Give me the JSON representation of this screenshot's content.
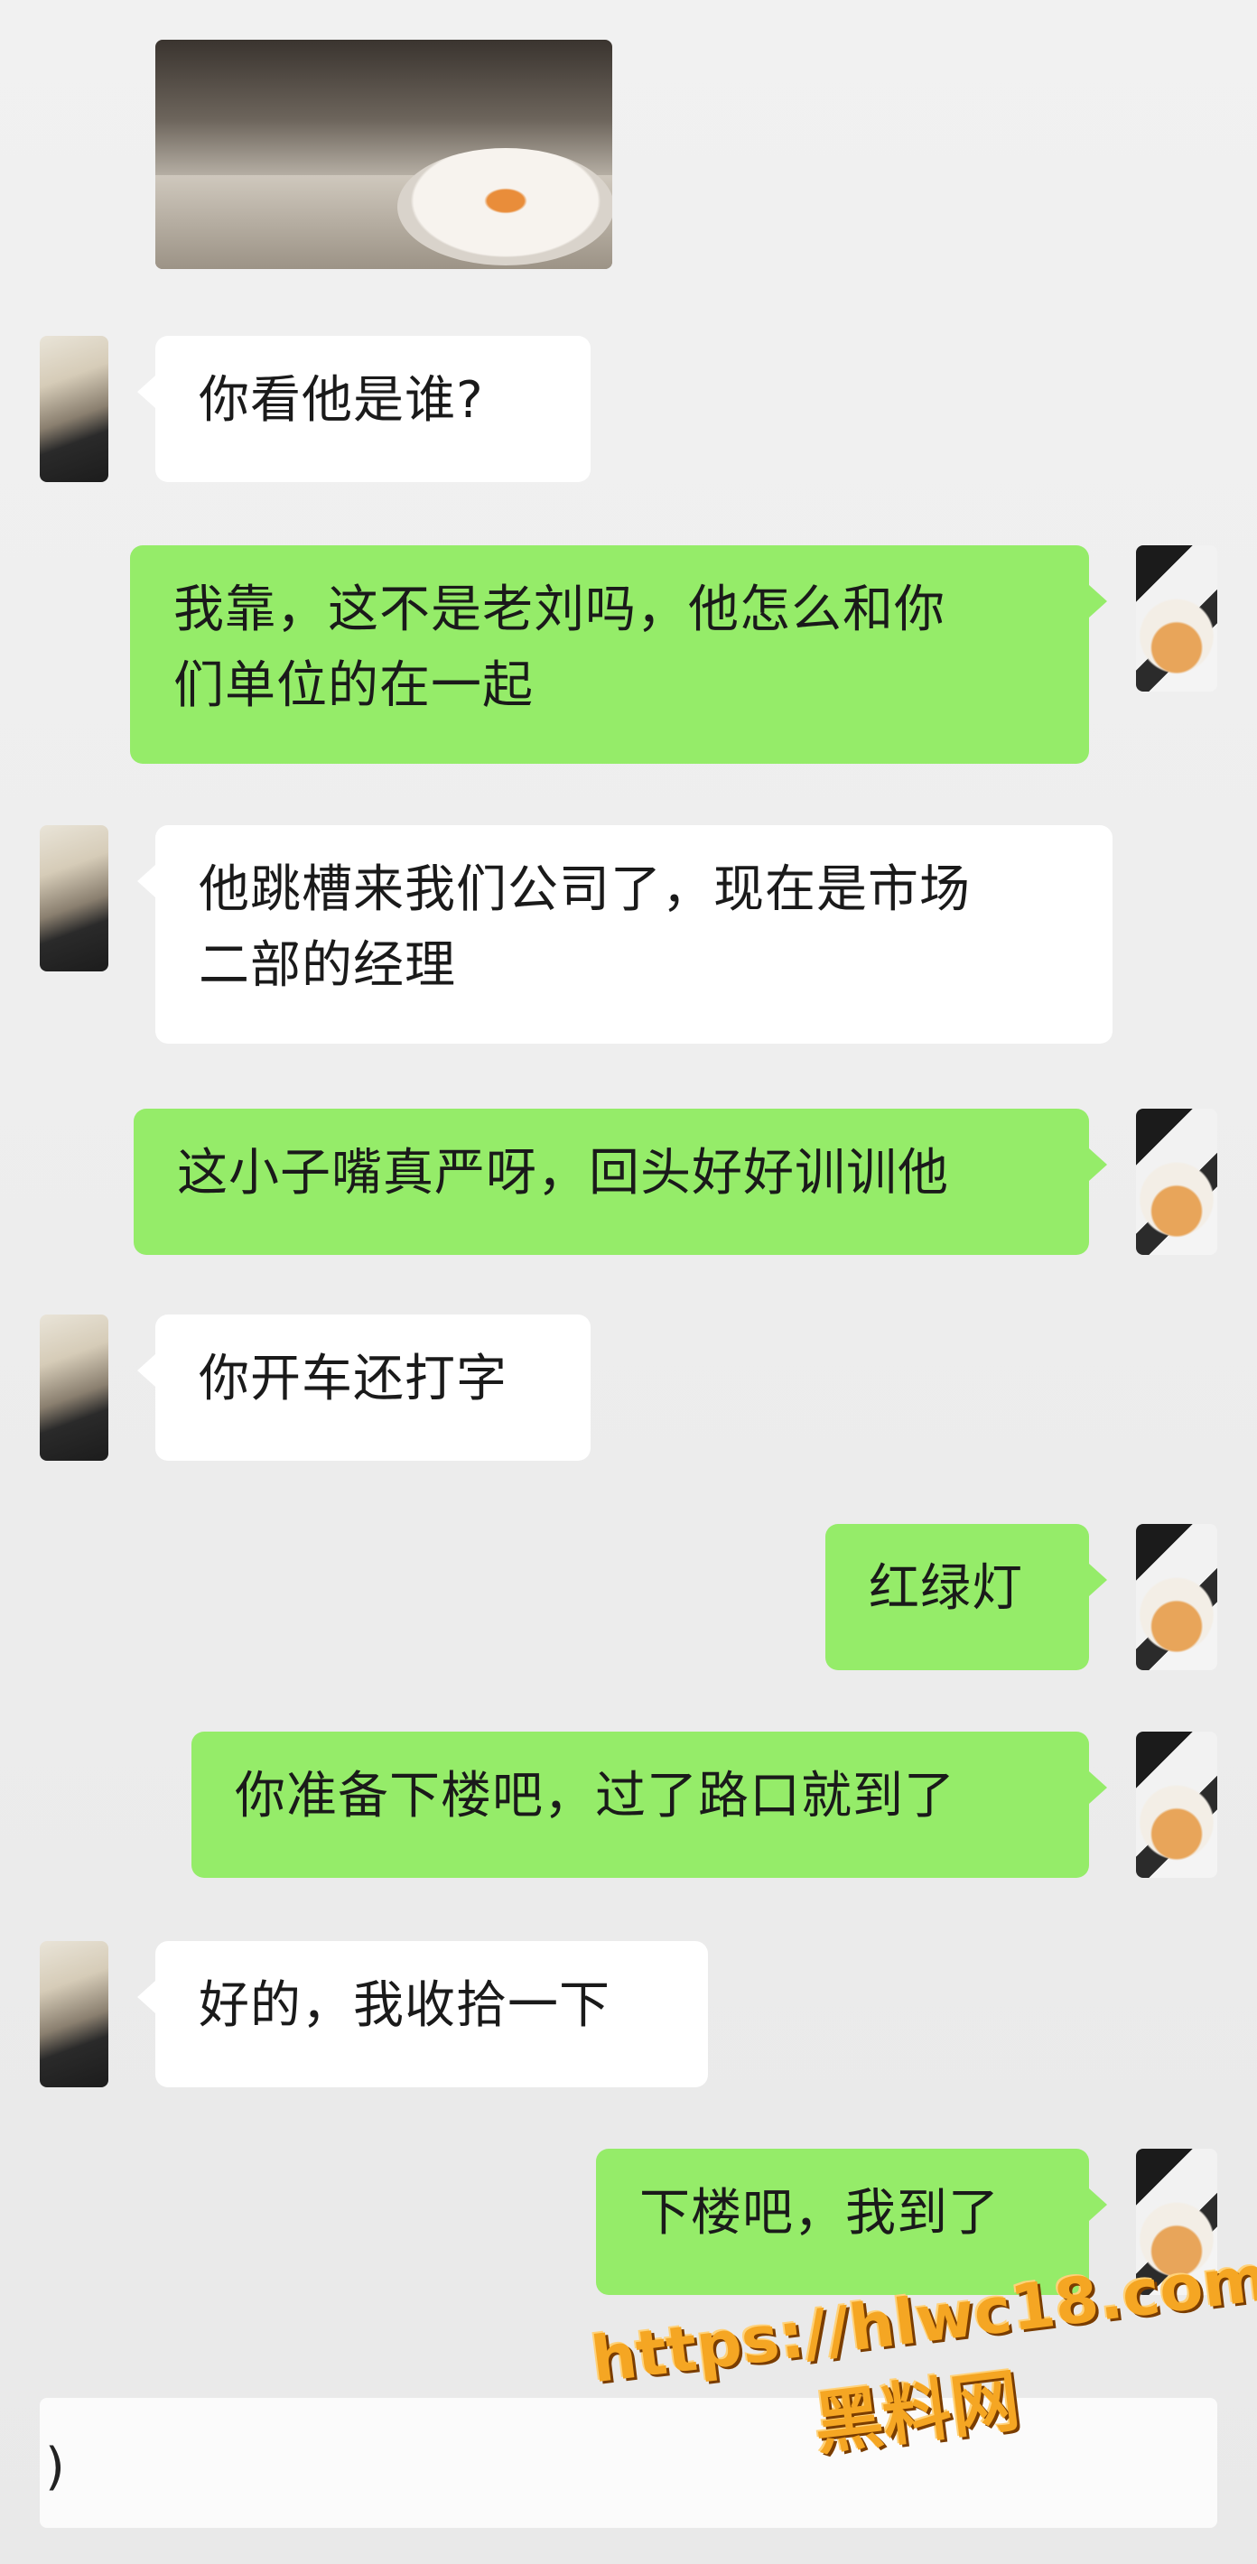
{
  "messages": [
    {
      "side": "in",
      "text": "你看他是谁?"
    },
    {
      "side": "out",
      "text": "我靠，这不是老刘吗，他怎么和你\n们单位的在一起"
    },
    {
      "side": "in",
      "text": "他跳槽来我们公司了，现在是市场\n二部的经理"
    },
    {
      "side": "out",
      "text": "这小子嘴真严呀，回头好好训训他"
    },
    {
      "side": "in",
      "text": "你开车还打字"
    },
    {
      "side": "out",
      "text": "红绿灯"
    },
    {
      "side": "out",
      "text": "你准备下楼吧，过了路口就到了"
    },
    {
      "side": "in",
      "text": "好的，我收拾一下"
    },
    {
      "side": "out",
      "text": "下楼吧，我到了"
    }
  ],
  "input": {
    "cursor_glyph": ")"
  },
  "watermark": {
    "url": "https://hlwc18.com",
    "site": "黑料网"
  },
  "colors": {
    "outgoing_bubble": "#95ec69",
    "incoming_bubble": "#ffffff",
    "background": "#ededed"
  }
}
